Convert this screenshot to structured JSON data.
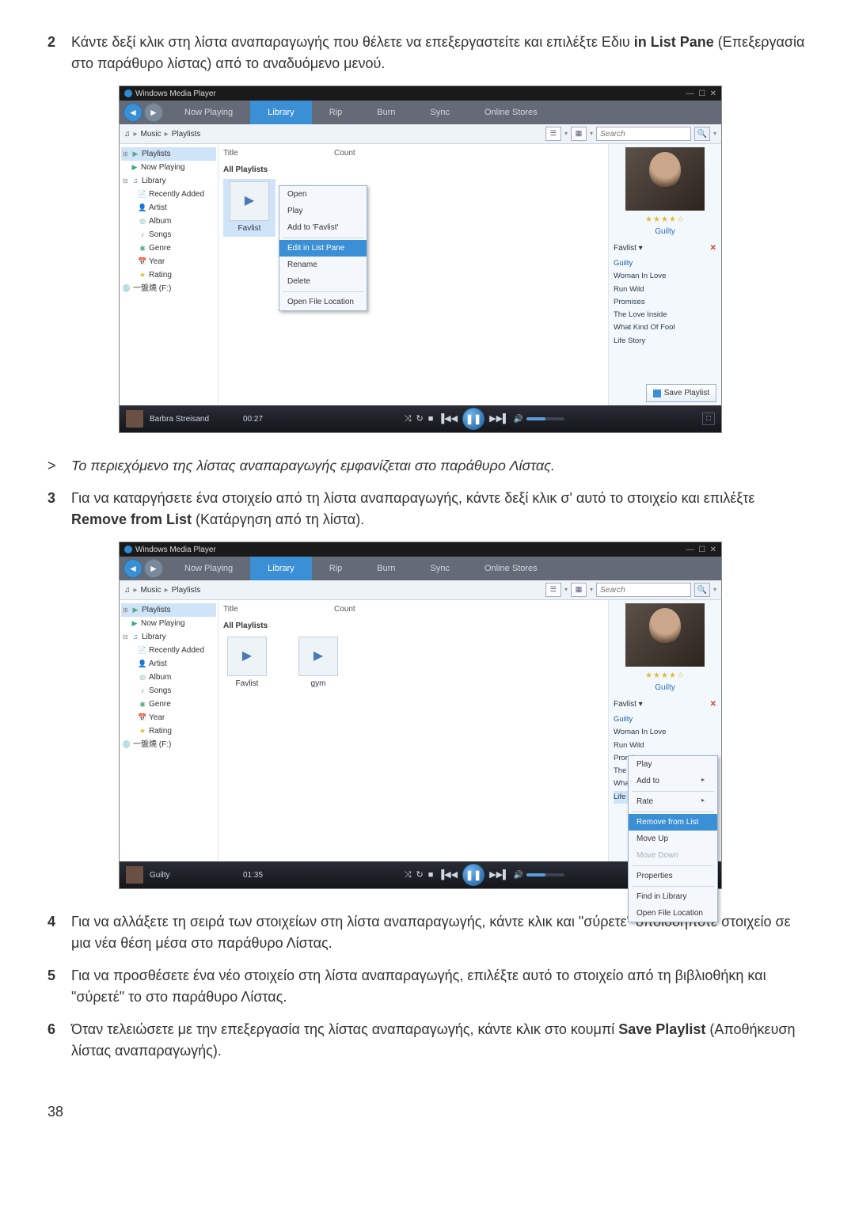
{
  "steps": {
    "s2": {
      "num": "2",
      "text_a": "Κάντε δεξί κλικ στη λίστα αναπαραγωγής που θέλετε να επεξεργαστείτε και επιλέξτε Εδιυ ",
      "bold": "in List Pane",
      "text_b": " (Επεξεργασία στο παράθυρο λίστας) από το αναδυόμενο μενού."
    },
    "note": {
      "marker": ">",
      "text": "Το περιεχόμενο της λίστας αναπαραγωγής εμφανίζεται στο παράθυρο Λίστας."
    },
    "s3": {
      "num": "3",
      "text_a": "Για να καταργήσετε ένα στοιχείο από τη λίστα αναπαραγωγής, κάντε δεξί κλικ σ' αυτό το στοιχείο και επιλέξτε ",
      "bold": "Remove from List",
      "text_b": " (Κατάργηση από τη λίστα)."
    },
    "s4": {
      "num": "4",
      "text": "Για να αλλάξετε τη σειρά των στοιχείων στη λίστα αναπαραγωγής, κάντε κλικ και \"σύρετε\" οποιοδήποτε στοιχείο σε μια νέα θέση μέσα στο παράθυρο Λίστας."
    },
    "s5": {
      "num": "5",
      "text": "Για να προσθέσετε ένα νέο στοιχείο στη λίστα αναπαραγωγής, επιλέξτε αυτό το στοιχείο από τη βιβλιοθήκη και \"σύρετέ\" το στο παράθυρο Λίστας."
    },
    "s6": {
      "num": "6",
      "text_a": "Όταν τελειώσετε με την επεξεργασία της λίστας αναπαραγωγής, κάντε κλικ στο κουμπί ",
      "bold": "Save Playlist",
      "text_b": " (Αποθήκευση λίστας αναπαραγωγής)."
    }
  },
  "page_number": "38",
  "wmp": {
    "title": "Windows Media Player",
    "tabs": {
      "np": "Now Playing",
      "lib": "Library",
      "rip": "Rip",
      "burn": "Burn",
      "sync": "Sync",
      "stores": "Online Stores"
    },
    "breadcrumb": {
      "root": "Music",
      "leaf": "Playlists"
    },
    "search_placeholder": "Search",
    "tree": {
      "playlists": "Playlists",
      "now_playing": "Now Playing",
      "library": "Library",
      "recently_added": "Recently Added",
      "artist": "Artist",
      "album": "Album",
      "songs": "Songs",
      "genre": "Genre",
      "year": "Year",
      "rating": "Rating",
      "drive": "一盤燒 (F:)"
    },
    "columns": {
      "title": "Title",
      "count": "Count"
    },
    "all_playlists": "All Playlists",
    "pl_items": {
      "favlist": "Favlist",
      "gym": "gym"
    },
    "ctx_a": {
      "open": "Open",
      "play": "Play",
      "addto": "Add to 'Favlist'",
      "edit": "Edit in List Pane",
      "rename": "Rename",
      "delete": "Delete",
      "openloc": "Open File Location"
    },
    "ctx_b": {
      "play": "Play",
      "addto": "Add to",
      "rate": "Rate",
      "remove": "Remove from List",
      "moveup": "Move Up",
      "movedown": "Move Down",
      "props": "Properties",
      "findlib": "Find in Library",
      "openloc": "Open File Location"
    },
    "right": {
      "stars": "★★★★☆",
      "album": "Guilty",
      "title": "Favlist ▾",
      "tracks": [
        "Guilty",
        "Woman In Love",
        "Run Wild",
        "Promises",
        "The Love Inside",
        "What Kind Of Fool",
        "Life Story"
      ],
      "save": "Save Playlist"
    },
    "player": {
      "a": {
        "track": "Barbra Streisand",
        "time": "00:27"
      },
      "b": {
        "track": "Guilty",
        "time": "01:35"
      }
    }
  }
}
